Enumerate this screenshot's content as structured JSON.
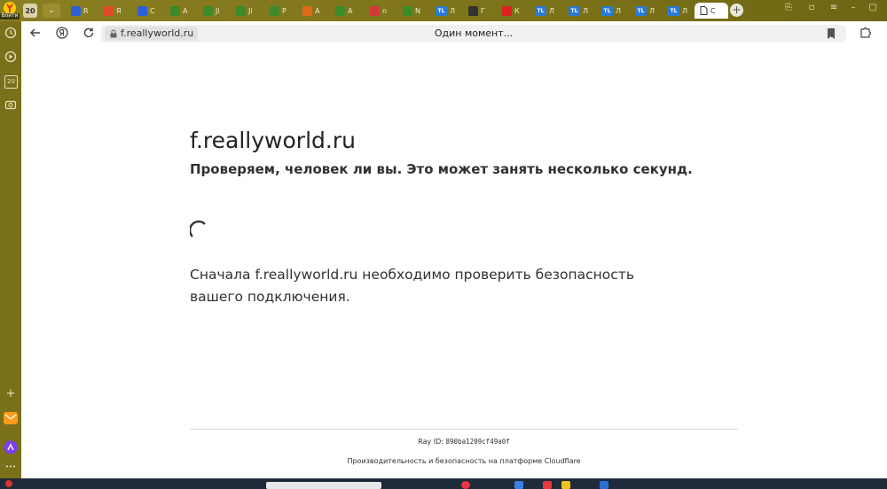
{
  "tabbar": {
    "yandex_logo_label": "Войти",
    "counter": "20",
    "tabs": [
      {
        "icon": "vk",
        "label": "R",
        "color": "#2a5fd6"
      },
      {
        "icon": "yandex",
        "label": "Я",
        "color": "#e04a2a"
      },
      {
        "icon": "vk",
        "label": "С",
        "color": "#2a5fd6"
      },
      {
        "icon": "minecraft",
        "label": "А",
        "color": "#3d8a2a"
      },
      {
        "icon": "minecraft",
        "label": "Ji",
        "color": "#3d8a2a"
      },
      {
        "icon": "minecraft",
        "label": "Ji",
        "color": "#3d8a2a"
      },
      {
        "icon": "minecraft",
        "label": "P",
        "color": "#3d8a2a"
      },
      {
        "icon": "fox",
        "label": "А",
        "color": "#e06a1a"
      },
      {
        "icon": "minecraft",
        "label": "А",
        "color": "#3d8a2a"
      },
      {
        "icon": "g",
        "label": "n",
        "color": "#d23a3a"
      },
      {
        "icon": "minecraft",
        "label": "N",
        "color": "#3d8a2a"
      },
      {
        "icon": "tl",
        "label": "Л",
        "color": "#2a7ad6"
      },
      {
        "icon": "smile",
        "label": "Г",
        "color": "#333333"
      },
      {
        "icon": "youtube",
        "label": "К",
        "color": "#e02020"
      },
      {
        "icon": "tl",
        "label": "Л",
        "color": "#2a7ad6"
      },
      {
        "icon": "tl",
        "label": "Л",
        "color": "#2a7ad6"
      },
      {
        "icon": "tl",
        "label": "Л",
        "color": "#2a7ad6"
      },
      {
        "icon": "tl",
        "label": "Л",
        "color": "#2a7ad6"
      },
      {
        "icon": "tl",
        "label": "Л",
        "color": "#2a7ad6"
      }
    ],
    "tl_text": "TL",
    "active_tab_label": "С",
    "new_tab": "+"
  },
  "sidebar": {
    "counter": "20",
    "plus": "+",
    "more": "•••"
  },
  "toolbar": {
    "url": "f.reallyworld.ru",
    "page_title": "Один момент..."
  },
  "page": {
    "site_title": "f.reallyworld.ru",
    "check_heading": "Проверяем, человек ли вы. Это может занять несколько секунд.",
    "explain_text": "Сначала f.reallyworld.ru необходимо проверить безопасность вашего подключения.",
    "ray_label": "Ray ID:",
    "ray_id": "890ba1209cf49a0f",
    "cloudflare_text": "Производительность и безопасность на платформе Cloudflare"
  },
  "colors": {
    "tabbar": "#7c7219",
    "accent_yandex": "#ffcc00",
    "text": "#313131"
  }
}
